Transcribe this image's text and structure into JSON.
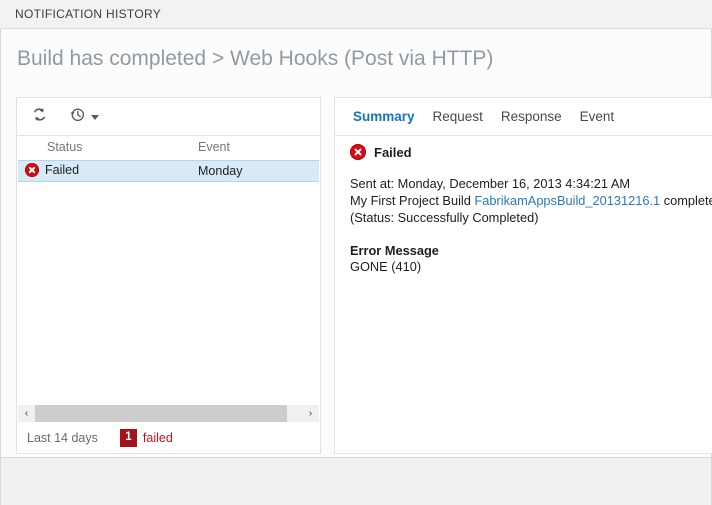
{
  "window": {
    "title": "NOTIFICATION HISTORY"
  },
  "header": {
    "heading": "Build has completed > Web Hooks (Post via HTTP)"
  },
  "left_panel": {
    "toolbar": {
      "refresh_icon": "refresh-icon",
      "history_icon": "history-clock-icon",
      "history_caret": "chevron-down-icon"
    },
    "columns": {
      "status": "Status",
      "event": "Event"
    },
    "rows": [
      {
        "status_icon": "error-icon",
        "status": "Failed",
        "event": "Monday"
      }
    ],
    "scrollbar": {
      "left_arrow": "‹",
      "right_arrow": "›"
    },
    "status_bar": {
      "range": "Last 14 days",
      "failed_count": "1",
      "failed_label": "failed"
    }
  },
  "right_panel": {
    "tabs": [
      {
        "label": "Summary",
        "active": true
      },
      {
        "label": "Request",
        "active": false
      },
      {
        "label": "Response",
        "active": false
      },
      {
        "label": "Event",
        "active": false
      }
    ],
    "detail": {
      "status_icon": "error-icon",
      "status": "Failed",
      "sent_at": "Sent at: Monday, December 16, 2013 4:34:21 AM",
      "body_prefix": "My First Project Build ",
      "body_link": "FabrikamAppsBuild_20131216.1",
      "body_suffix": " completed (Status: Successfully Completed)",
      "error_heading": "Error Message",
      "error_text": "GONE (410)"
    }
  },
  "colors": {
    "accent": "#1a72c4",
    "error_red": "#d60c14",
    "badge_red": "#a4131b",
    "link": "#2a7ac0",
    "selection": "#d9eaf7",
    "heading_gray": "#8f9aa3"
  }
}
